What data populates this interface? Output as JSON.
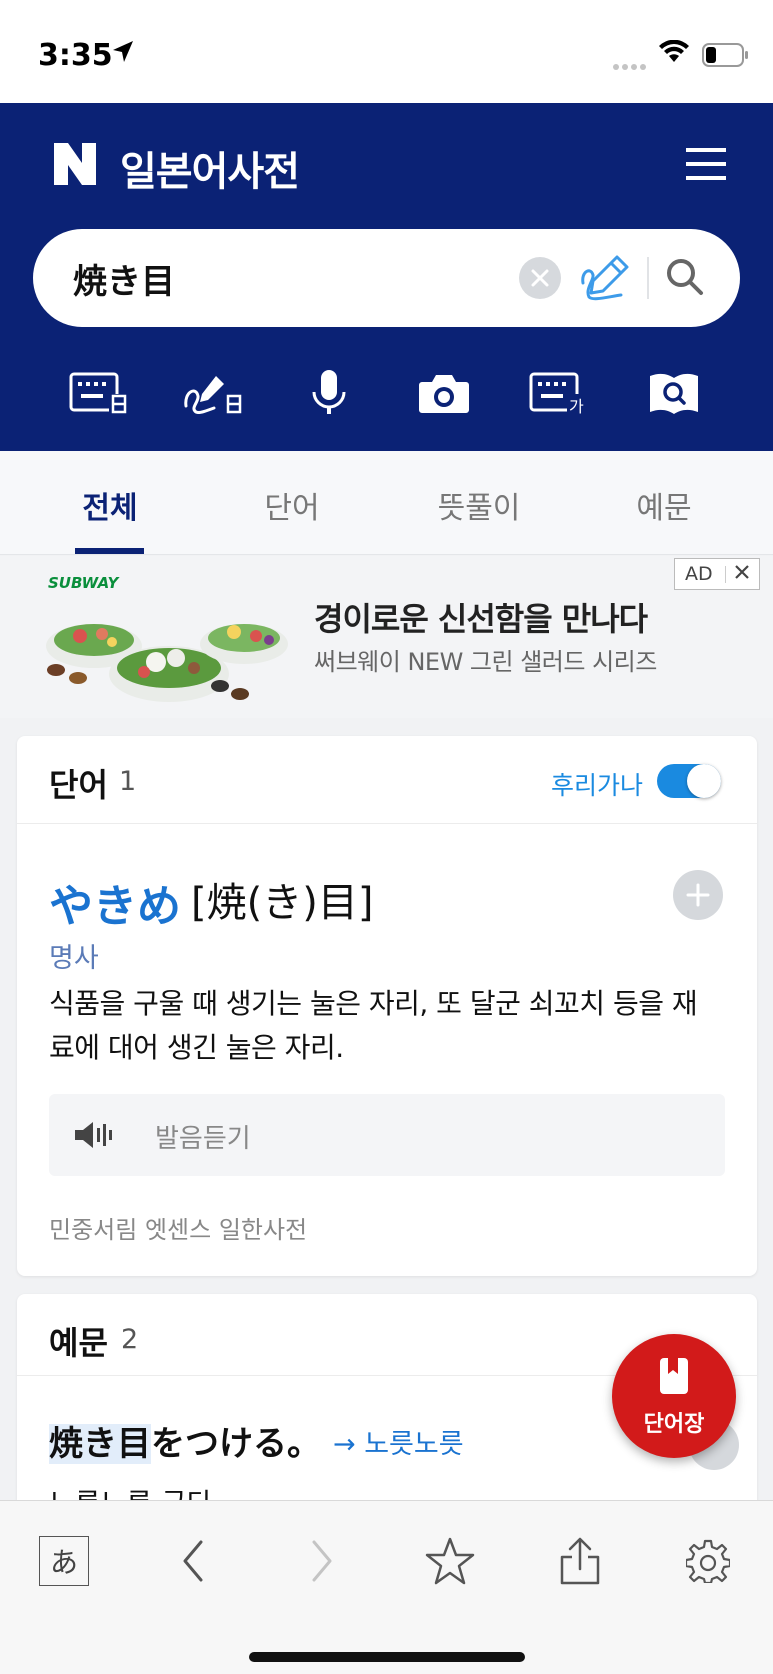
{
  "status_bar": {
    "time": "3:35"
  },
  "header": {
    "logo": "N",
    "title": "일본어사전",
    "search_value": "焼き目"
  },
  "tabs": [
    {
      "label": "전체",
      "active": true
    },
    {
      "label": "단어",
      "active": false
    },
    {
      "label": "뜻풀이",
      "active": false
    },
    {
      "label": "예문",
      "active": false
    }
  ],
  "ad": {
    "brand": "SUBWAY",
    "headline": "경이로운 신선함을 만나다",
    "subline": "써브웨이 NEW 그린 샐러드 시리즈",
    "tag": "AD"
  },
  "word_section": {
    "title": "단어",
    "count": "1",
    "furigana_label": "후리가나",
    "furigana_on": true,
    "entry": {
      "reading": "やきめ",
      "kanji": "[焼(き)目]",
      "part_of_speech": "명사",
      "definition": "식품을 구울 때 생기는 눌은 자리, 또 달군 쇠꼬치 등을 재료에 대어 생긴 눌은 자리.",
      "pronunciation_label": "발음듣기",
      "source": "민중서림 엣센스 일한사전"
    }
  },
  "example_section": {
    "title": "예문",
    "count": "2",
    "example_highlight": "焼き目",
    "example_rest": "をつける。",
    "link_label": "→ 노릇노릇",
    "translation": "노릇노릇 굽다"
  },
  "fab": {
    "label": "단어장"
  },
  "toolbar": {
    "kana_label": "あ"
  },
  "colors": {
    "brand_navy": "#0b2275",
    "accent_blue": "#1a73d0",
    "fab_red": "#d21a1a"
  }
}
